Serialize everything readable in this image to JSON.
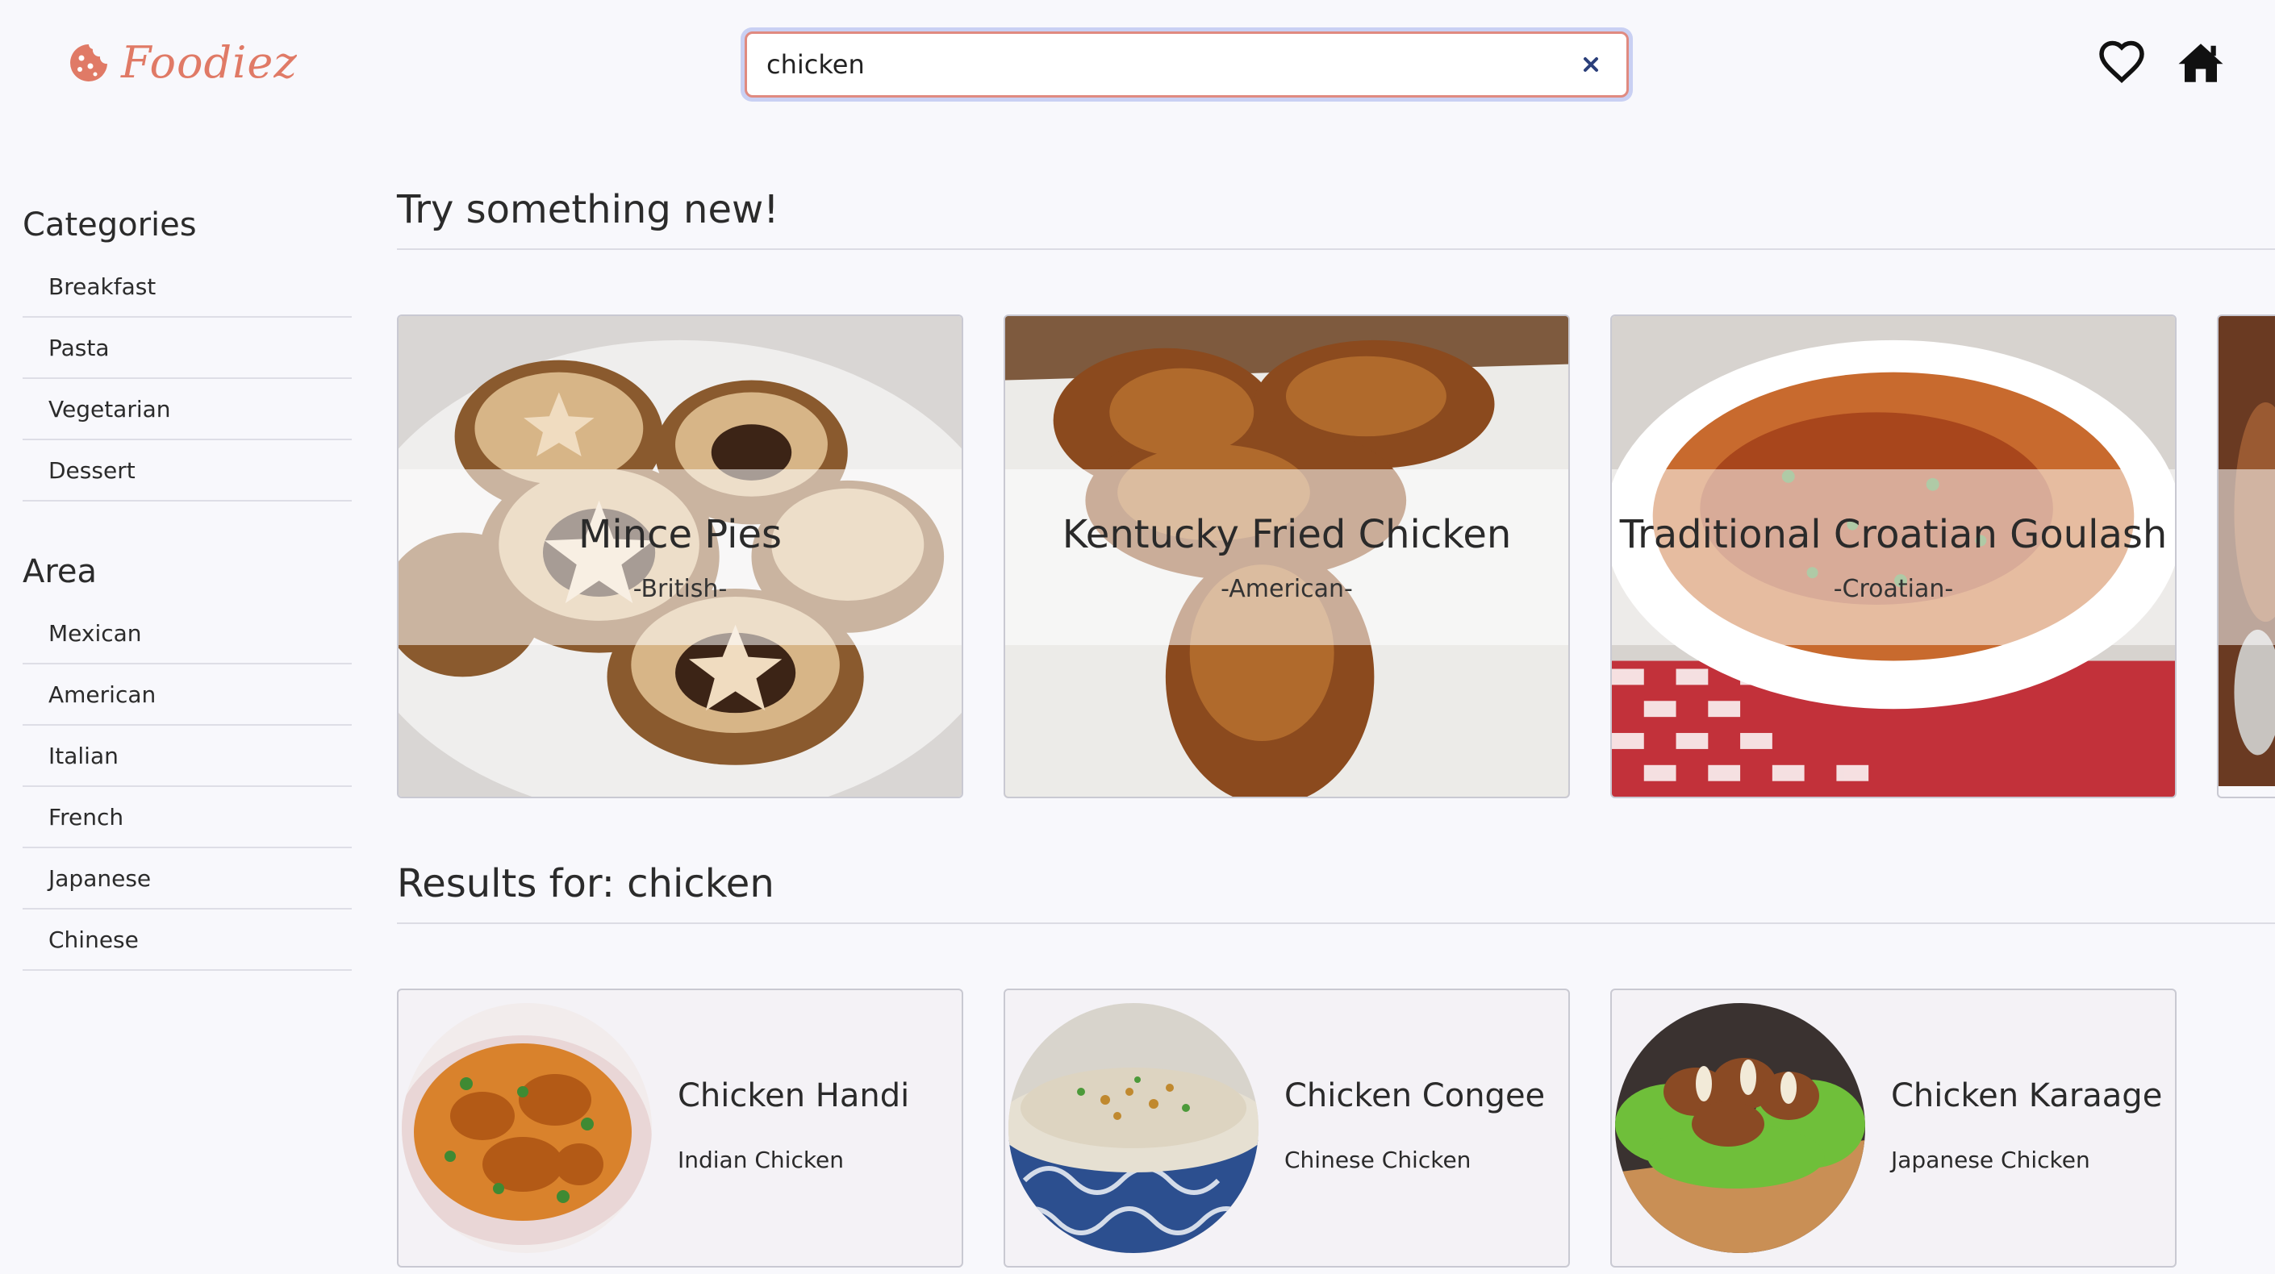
{
  "brand": {
    "name": "Foodiez",
    "accent": "#e07a66"
  },
  "search": {
    "value": "chicken",
    "placeholder": "Search"
  },
  "header_icons": [
    "heart-icon",
    "home-icon"
  ],
  "sidebar": {
    "categories_heading": "Categories",
    "categories": [
      "Breakfast",
      "Pasta",
      "Vegetarian",
      "Dessert"
    ],
    "area_heading": "Area",
    "areas": [
      "Mexican",
      "American",
      "Italian",
      "French",
      "Japanese",
      "Chinese"
    ]
  },
  "random": {
    "title": "Try something new!",
    "cards": [
      {
        "name": "Mince Pies",
        "area": "-British-"
      },
      {
        "name": "Kentucky Fried Chicken",
        "area": "-American-"
      },
      {
        "name": "Traditional Croatian Goulash",
        "area": "-Croatian-"
      }
    ]
  },
  "results": {
    "title": "Results for: chicken",
    "cards": [
      {
        "name": "Chicken Handi",
        "subtitle": "Indian Chicken"
      },
      {
        "name": "Chicken Congee",
        "subtitle": "Chinese Chicken"
      },
      {
        "name": "Chicken Karaage",
        "subtitle": "Japanese Chicken"
      }
    ]
  }
}
